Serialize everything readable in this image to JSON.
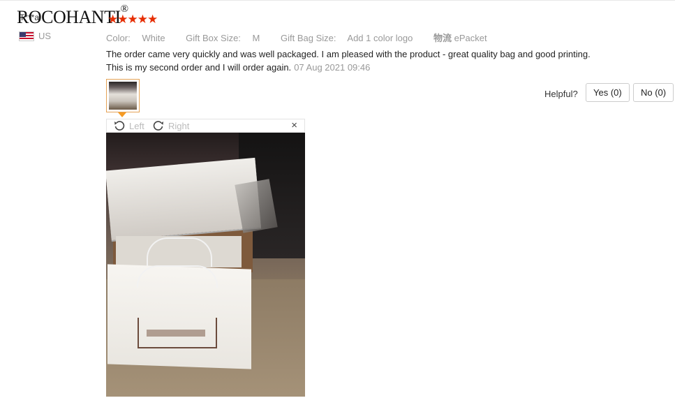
{
  "review": {
    "reviewer_name": "T***a",
    "watermark": "ROCOHANTI",
    "watermark_mark": "®",
    "stars": "★★★★★",
    "rating": 5,
    "country": "US",
    "attributes": [
      {
        "label": "Color:",
        "value": "White"
      },
      {
        "label": "Gift Box Size:",
        "value": "M"
      },
      {
        "label": "Gift Bag Size:",
        "value": "Add 1 color logo"
      }
    ],
    "shipping_label": "物流",
    "shipping_method": "ePacket",
    "text_line1": "The order came very quickly and was well packaged. I am pleased with the product - great quality bag and good printing.",
    "text_line2": "This is my second order and I will order again.",
    "date": "07 Aug 2021 09:46"
  },
  "helpful": {
    "label": "Helpful?",
    "yes_label": "Yes (0)",
    "no_label": "No (0)"
  },
  "viewer": {
    "rotate_left": "Left",
    "rotate_right": "Right",
    "close": "×"
  },
  "icons": {
    "flag": "us-flag-icon",
    "rotate_left": "rotate-left-icon",
    "rotate_right": "rotate-right-icon",
    "close": "close-icon"
  },
  "colors": {
    "star": "#e62e04",
    "thumb_border": "#e5a356",
    "muted_text": "#999999"
  }
}
